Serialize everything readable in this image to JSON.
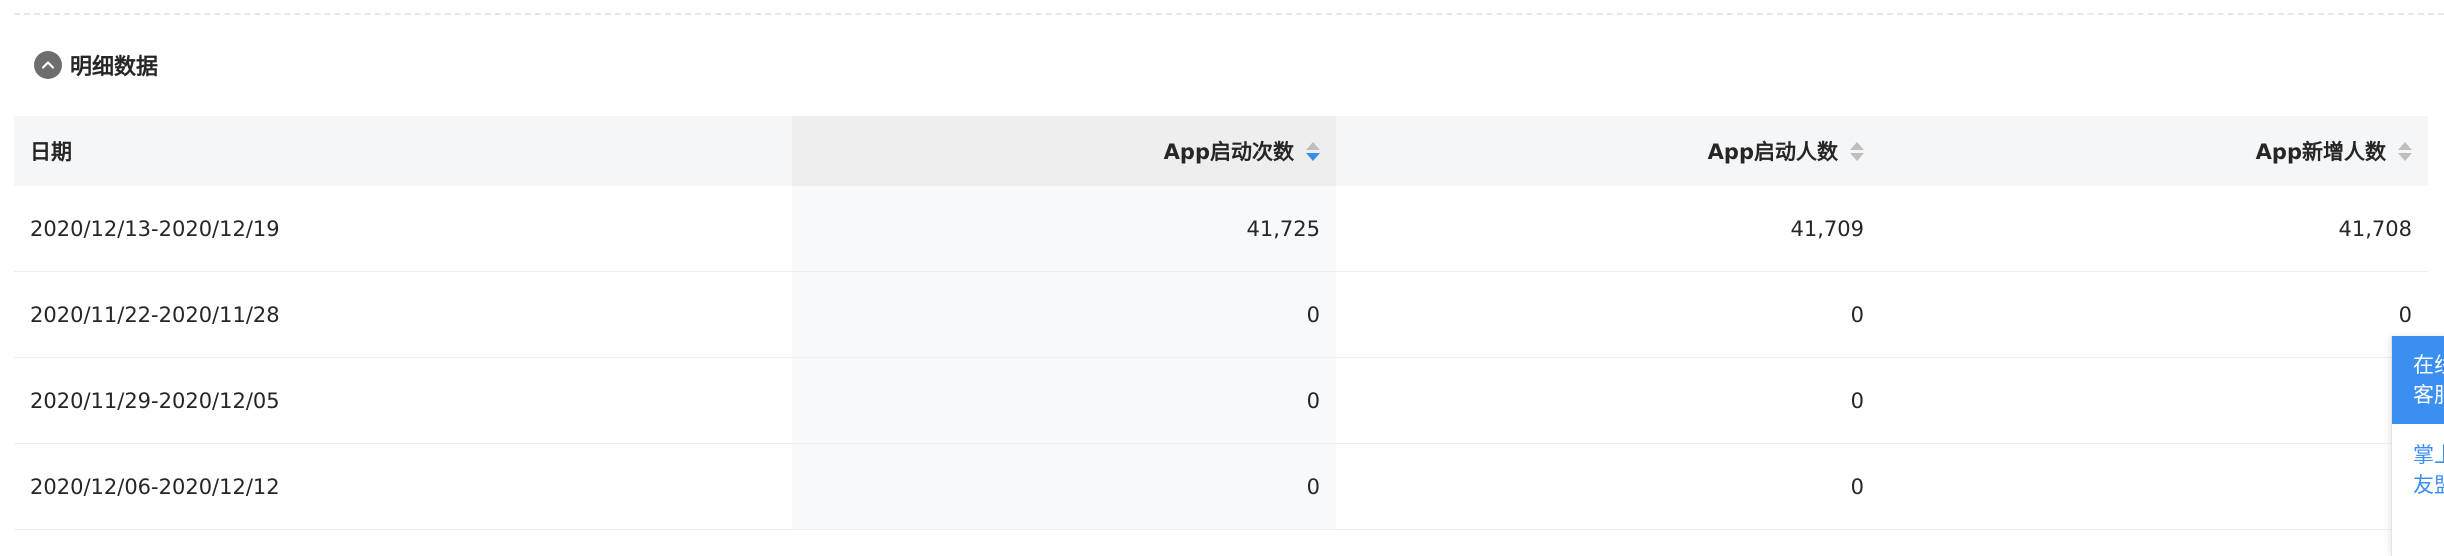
{
  "section": {
    "title": "明细数据"
  },
  "table": {
    "columns": [
      "日期",
      "App启动次数",
      "App启动人数",
      "App新增人数"
    ],
    "rows": [
      [
        "2020/12/13-2020/12/19",
        "41,725",
        "41,709",
        "41,708"
      ],
      [
        "2020/11/22-2020/11/28",
        "0",
        "0",
        "0"
      ],
      [
        "2020/11/29-2020/12/05",
        "0",
        "0",
        ""
      ],
      [
        "2020/12/06-2020/12/12",
        "0",
        "0",
        ""
      ]
    ],
    "sorted_column": "App启动次数",
    "sort_direction": "descending"
  },
  "float_panel": {
    "top_text": "在线\n客服",
    "bottom_text": "掌上\n友盟"
  },
  "colors": {
    "accent": "#3b8ff0",
    "sort_active": "#3a8ee6"
  },
  "icons": {
    "collapse": "chevron-up-icon",
    "sort": "sort-caret-icon"
  }
}
